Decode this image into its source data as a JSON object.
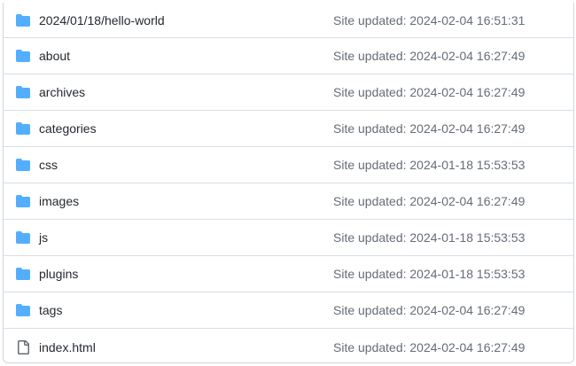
{
  "colors": {
    "folder_icon": "#54aeff",
    "file_icon": "#656d76",
    "name_text": "#24292f",
    "meta_text": "#656d76",
    "border": "#d0d7de"
  },
  "files": [
    {
      "name": "2024/01/18/hello-world",
      "type": "folder",
      "icon": "folder-icon",
      "message": "Site updated: 2024-02-04 16:51:31"
    },
    {
      "name": "about",
      "type": "folder",
      "icon": "folder-icon",
      "message": "Site updated: 2024-02-04 16:27:49"
    },
    {
      "name": "archives",
      "type": "folder",
      "icon": "folder-icon",
      "message": "Site updated: 2024-02-04 16:27:49"
    },
    {
      "name": "categories",
      "type": "folder",
      "icon": "folder-icon",
      "message": "Site updated: 2024-02-04 16:27:49"
    },
    {
      "name": "css",
      "type": "folder",
      "icon": "folder-icon",
      "message": "Site updated: 2024-01-18 15:53:53"
    },
    {
      "name": "images",
      "type": "folder",
      "icon": "folder-icon",
      "message": "Site updated: 2024-02-04 16:27:49"
    },
    {
      "name": "js",
      "type": "folder",
      "icon": "folder-icon",
      "message": "Site updated: 2024-01-18 15:53:53"
    },
    {
      "name": "plugins",
      "type": "folder",
      "icon": "folder-icon",
      "message": "Site updated: 2024-01-18 15:53:53"
    },
    {
      "name": "tags",
      "type": "folder",
      "icon": "folder-icon",
      "message": "Site updated: 2024-02-04 16:27:49"
    },
    {
      "name": "index.html",
      "type": "file",
      "icon": "file-icon",
      "message": "Site updated: 2024-02-04 16:27:49"
    }
  ]
}
